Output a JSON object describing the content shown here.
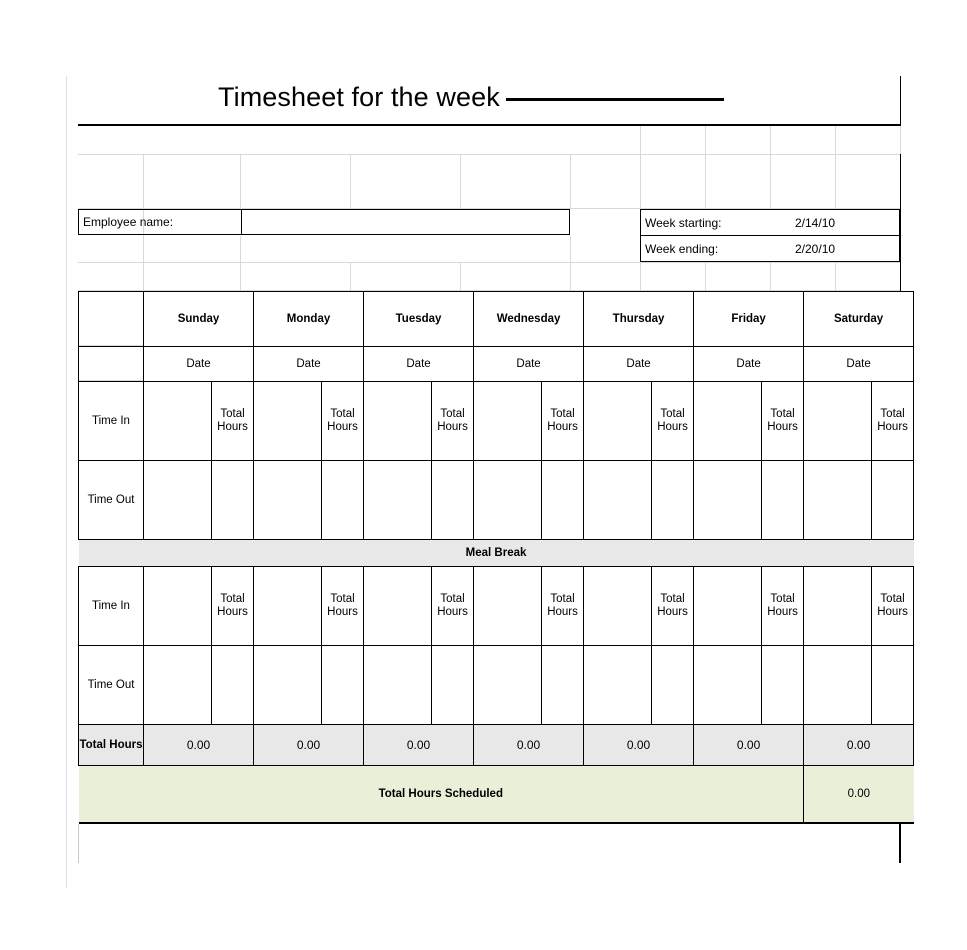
{
  "document": {
    "title_text": "Timesheet for the week",
    "title_blank": ""
  },
  "info": {
    "employee_label": "Employee name:",
    "employee_value": "",
    "week_starting_label": "Week starting:",
    "week_starting_value": "2/14/10",
    "week_ending_label": "Week ending:",
    "week_ending_value": "2/20/10"
  },
  "table": {
    "days": [
      "Sunday",
      "Monday",
      "Tuesday",
      "Wednesday",
      "Thursday",
      "Friday",
      "Saturday"
    ],
    "date_label": "Date",
    "total_hours_label": "Total Hours",
    "time_in_label": "Time In",
    "time_out_label": "Time Out",
    "meal_break_label": "Meal Break",
    "totals_row_label": "Total Hours",
    "daily_totals": [
      "0.00",
      "0.00",
      "0.00",
      "0.00",
      "0.00",
      "0.00",
      "0.00"
    ],
    "scheduled_label": "Total Hours Scheduled",
    "scheduled_value": "0.00",
    "time_in_values": [
      "",
      "",
      "",
      "",
      "",
      "",
      ""
    ],
    "time_out_values": [
      "",
      "",
      "",
      "",
      "",
      "",
      ""
    ],
    "hours_values": [
      "",
      "",
      "",
      "",
      "",
      "",
      ""
    ],
    "date_values": [
      "",
      "",
      "",
      "",
      "",
      "",
      ""
    ],
    "break_in_values": [
      "",
      "",
      "",
      "",
      "",
      "",
      ""
    ],
    "break_out_values": [
      "",
      "",
      "",
      "",
      "",
      "",
      ""
    ],
    "break_hours_values": [
      "",
      "",
      "",
      "",
      "",
      "",
      ""
    ]
  },
  "colors": {
    "header_green": "#EAEFD7",
    "date_cream": "#FBF9EE",
    "total_gray": "#E8E8E8",
    "border": "#000000"
  }
}
